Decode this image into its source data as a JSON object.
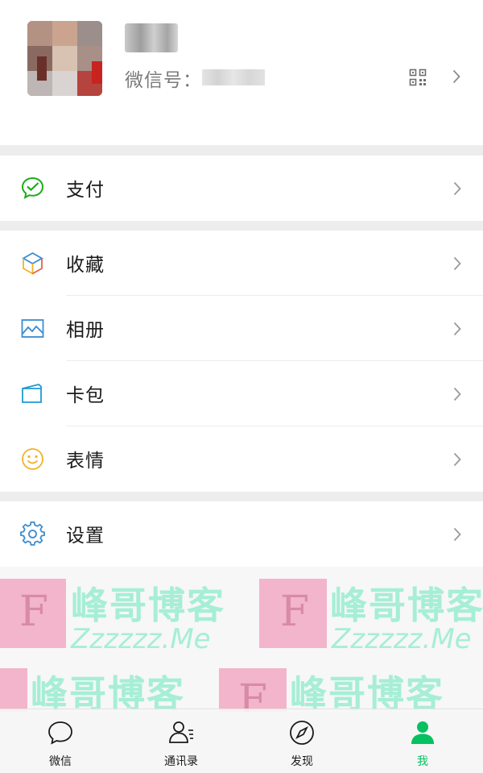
{
  "profile": {
    "wechat_id_label": "微信号："
  },
  "menu": {
    "pay": "支付",
    "favorites": "收藏",
    "album": "相册",
    "cards": "卡包",
    "stickers": "表情",
    "settings": "设置"
  },
  "watermark": {
    "letter": "F",
    "cn": "峰哥博客",
    "en": "Zzzzzz.Me"
  },
  "tabbar": {
    "chats": "微信",
    "contacts": "通讯录",
    "discover": "发现",
    "me": "我"
  },
  "colors": {
    "accent": "#07c160",
    "icon_blue": "#3a8ccf",
    "icon_green": "#1aad19",
    "icon_yellow": "#f2b227"
  }
}
